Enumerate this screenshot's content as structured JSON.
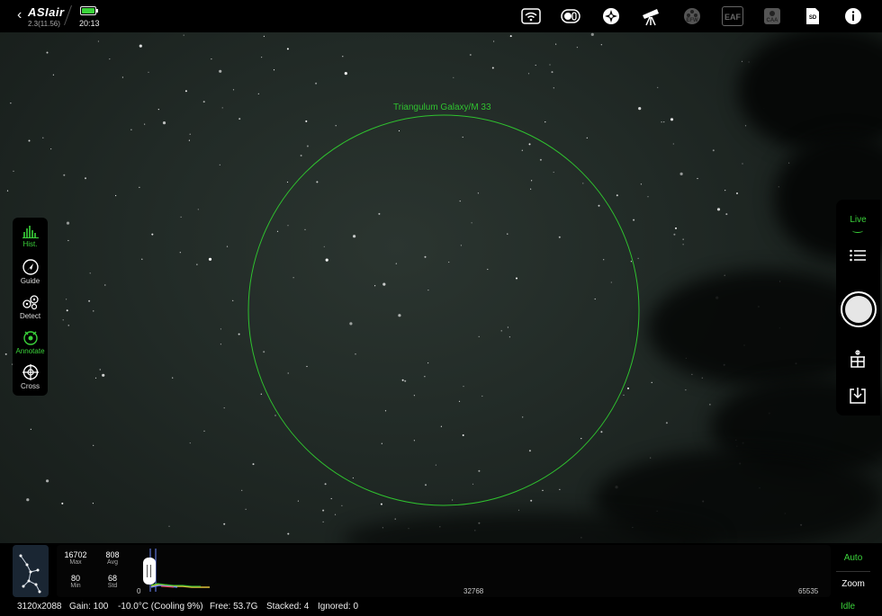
{
  "header": {
    "brand": "ASIair",
    "version": "2.3(11.56)",
    "time": "20:13",
    "battery_color": "#3ad23a",
    "icons": [
      "wifi-icon",
      "camera-switch-icon",
      "mount-icon",
      "telescope-icon",
      "efw-icon",
      "eaf-icon",
      "caa-icon",
      "sd-card-icon",
      "info-icon"
    ],
    "efw_label": "EFW",
    "eaf_label": "EAF",
    "caa_label": "CAA",
    "sd_label": "SD"
  },
  "left_tools": [
    {
      "label": "Hist.",
      "icon": "histogram-icon",
      "active": true
    },
    {
      "label": "Guide",
      "icon": "guide-icon",
      "active": false
    },
    {
      "label": "Detect",
      "icon": "detect-icon",
      "active": false
    },
    {
      "label": "Annotate",
      "icon": "annotate-icon",
      "active": true
    },
    {
      "label": "Cross",
      "icon": "crosshair-icon",
      "active": false
    }
  ],
  "annotation": {
    "target_label": "Triangulum Galaxy/M 33",
    "circle_color": "#2fc22f"
  },
  "right_panel": {
    "mode": "Live",
    "icons": [
      "menu-list-icon",
      "shutter-button",
      "filter-wheel-icon",
      "save-download-icon"
    ]
  },
  "histogram": {
    "max": "16702",
    "max_label": "Max",
    "avg": "808",
    "avg_label": "Avg",
    "min": "80",
    "min_label": "Min",
    "std": "68",
    "std_label": "Std",
    "axis_min": "0",
    "axis_mid": "32768",
    "axis_max": "65535"
  },
  "stretch_buttons": {
    "auto": "Auto",
    "zoom": "Zoom",
    "state": "Idle"
  },
  "status_bar": {
    "resolution": "3120x2088",
    "gain": "Gain: 100",
    "temperature": "-10.0°C (Cooling 9%)",
    "free": "Free: 53.7G",
    "stacked": "Stacked: 4",
    "ignored": "Ignored: 0"
  },
  "accent_color": "#3ad23a"
}
